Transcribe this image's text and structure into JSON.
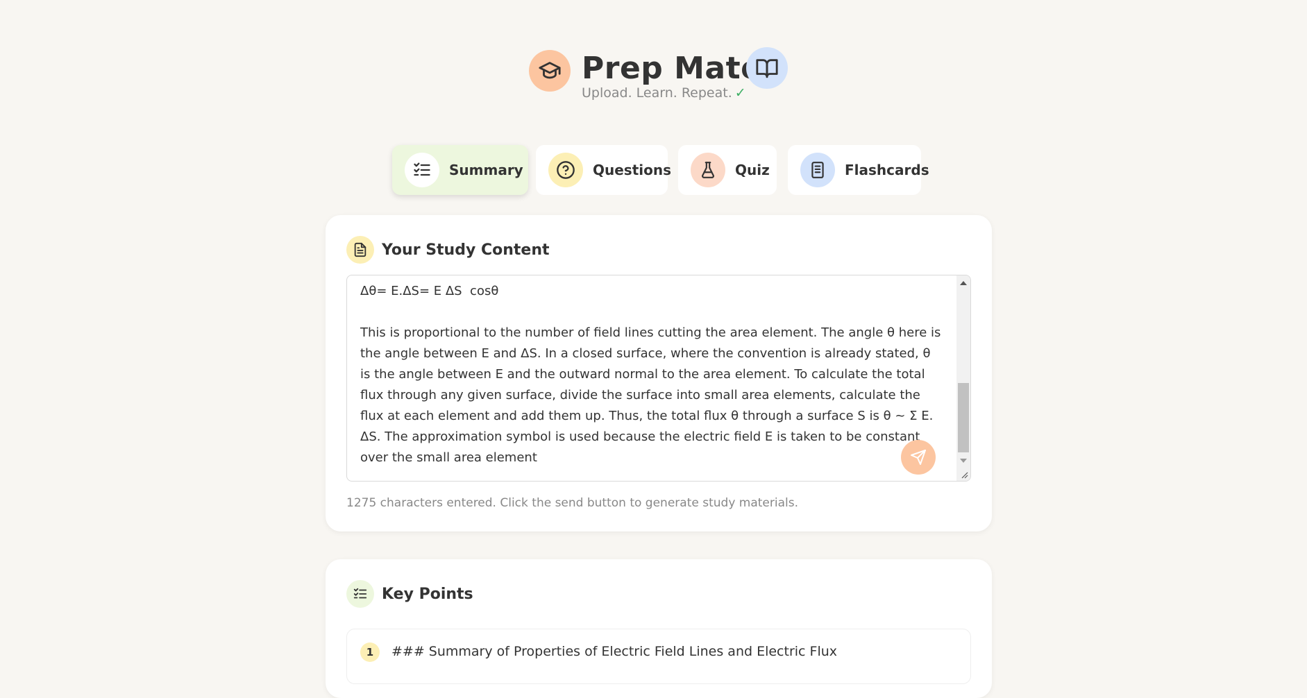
{
  "header": {
    "title": "Prep Mate",
    "tagline": "Upload. Learn. Repeat.",
    "tagline_check": "✓"
  },
  "tabs": [
    {
      "label": "Summary",
      "icon": "checklist-icon",
      "active": true
    },
    {
      "label": "Questions",
      "icon": "question-circle-icon",
      "active": false
    },
    {
      "label": "Quiz",
      "icon": "flask-icon",
      "active": false
    },
    {
      "label": "Flashcards",
      "icon": "notebook-icon",
      "active": false
    }
  ],
  "study_content": {
    "heading": "Your Study Content",
    "text": "Δθ= E.ΔS= E ΔS  cosθ\n\nThis is proportional to the number of field lines cutting the area element. The angle θ here is the angle between E and ΔS. In a closed surface, where the convention is already stated, θ is the angle between E and the outward normal to the area element. To calculate the total flux through any given surface, divide the surface into small area elements, calculate the flux at each element and add them up. Thus, the total flux θ through a surface S is θ ~ Σ E. ΔS. The approximation symbol is used because the electric field E is taken to be constant over the small area element",
    "char_count_text": "1275 characters entered. Click the send button to generate study materials."
  },
  "key_points": {
    "heading": "Key Points",
    "items": [
      {
        "number": "1",
        "text": "### Summary of Properties of Electric Field Lines and Electric Flux"
      }
    ]
  },
  "colors": {
    "background": "#f8f6f2",
    "active_tab": "#edf7de",
    "peach": "#fcc5a0",
    "yellow": "#fcefb5",
    "blue": "#d2e2fb",
    "green_check": "#3cae63"
  }
}
